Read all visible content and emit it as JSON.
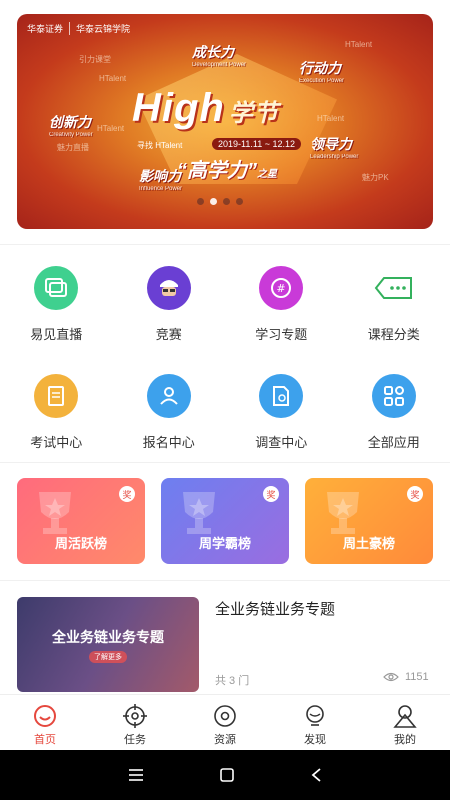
{
  "banner": {
    "brand1": "华泰证券",
    "brand2": "华泰云锦学院",
    "headline_en": "High",
    "headline_cn": "学节",
    "dates": "2019-11.11 ~ 12.12",
    "subtitle_left": "寻找 HTalent",
    "slogan": "“高学力”",
    "slogan_small": "之星",
    "tags": [
      {
        "cn": "成长力",
        "en": "Development Power"
      },
      {
        "cn": "行动力",
        "en": "Execution Power"
      },
      {
        "cn": "创新力",
        "en": "Creativity Power"
      },
      {
        "cn": "领导力",
        "en": "Leadership Power"
      },
      {
        "cn": "影响力",
        "en": "Influence Power"
      }
    ],
    "faint": [
      "引力课堂",
      "HTalent",
      "魅力直播",
      "HTalent",
      "魅力PK",
      "HTalent",
      "HTalent"
    ],
    "slide_count": 4,
    "active_slide": 2
  },
  "grid_row1": [
    {
      "label": "易见直播",
      "icon": "live-icon",
      "color": "#3fd08f"
    },
    {
      "label": "竞赛",
      "icon": "contest-icon",
      "color": "#6a3fd3"
    },
    {
      "label": "学习专题",
      "icon": "topic-icon",
      "color": "#c93ad8"
    },
    {
      "label": "课程分类",
      "icon": "category-icon",
      "color": "#34b15d"
    }
  ],
  "grid_row2": [
    {
      "label": "考试中心",
      "icon": "exam-icon",
      "color": "#f3b23c"
    },
    {
      "label": "报名中心",
      "icon": "signup-icon",
      "color": "#3da1ec"
    },
    {
      "label": "调查中心",
      "icon": "survey-icon",
      "color": "#3da1ec"
    },
    {
      "label": "全部应用",
      "icon": "apps-icon",
      "color": "#3da1ec"
    }
  ],
  "cards": [
    {
      "title": "周活跃榜",
      "badge": "奖",
      "color_from": "#ff6b7d",
      "color_to": "#ff8a6a"
    },
    {
      "title": "周学霸榜",
      "badge": "奖",
      "color_from": "#6d7ff0",
      "color_to": "#9a6de0"
    },
    {
      "title": "周土豪榜",
      "badge": "奖",
      "color_from": "#ffb03a",
      "color_to": "#ff8a3a"
    }
  ],
  "course": {
    "title": "全业务链业务专题",
    "thumb_title": "全业务链业务专题",
    "thumb_button": "了解更多",
    "count": "共 3 门",
    "views": "1151"
  },
  "nav": [
    {
      "label": "首页",
      "icon": "home-icon",
      "active": true
    },
    {
      "label": "任务",
      "icon": "target-icon",
      "active": false
    },
    {
      "label": "资源",
      "icon": "disc-icon",
      "active": false
    },
    {
      "label": "发现",
      "icon": "bulb-icon",
      "active": false
    },
    {
      "label": "我的",
      "icon": "profile-icon",
      "active": false
    }
  ],
  "colors": {
    "accent": "#e5483e"
  }
}
